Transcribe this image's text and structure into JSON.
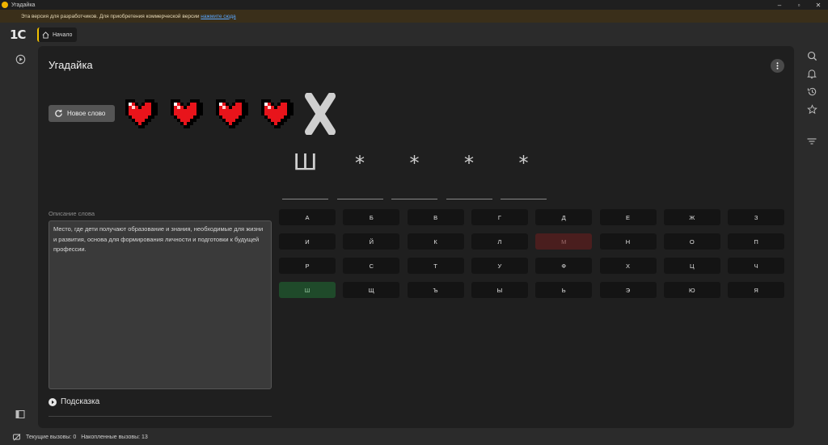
{
  "window": {
    "title": "Угадайка"
  },
  "banner": {
    "text": "Эта версия для разработчиков. Для приобретения коммерческой версии ",
    "link": "нажмите сюда"
  },
  "topbar": {
    "logo": "1С",
    "home_tab": "Начало"
  },
  "panel": {
    "title": "Угадайка",
    "new_word_label": "Новое слово",
    "hearts_remaining": 4,
    "hearts_lost": 1,
    "word_slots": [
      "Ш",
      "*",
      "*",
      "*",
      "*"
    ],
    "description_label": "Описание слова",
    "description_text": "Место, где дети получают образование и знания, необходимые для жизни и развития, основа для формирования личности и подготовки к будущей профессии.",
    "hint_label": "Подсказка"
  },
  "keyboard": {
    "rows": [
      [
        "А",
        "Б",
        "В",
        "Г",
        "Д",
        "Е",
        "Ж",
        "З"
      ],
      [
        "И",
        "Й",
        "К",
        "Л",
        "М",
        "Н",
        "О",
        "П"
      ],
      [
        "Р",
        "С",
        "Т",
        "У",
        "Ф",
        "Х",
        "Ц",
        "Ч"
      ],
      [
        "Ш",
        "Щ",
        "Ъ",
        "Ы",
        "Ь",
        "Э",
        "Ю",
        "Я"
      ]
    ],
    "wrong": [
      "М"
    ],
    "correct": [
      "Ш"
    ]
  },
  "status": {
    "current_calls": "Текущие вызовы: 0",
    "accumulated_calls": "Накопленные вызовы: 13"
  },
  "colors": {
    "heart": "#e8141b",
    "correct_key": "#1f4a2a",
    "wrong_key": "#4a1e1e"
  }
}
